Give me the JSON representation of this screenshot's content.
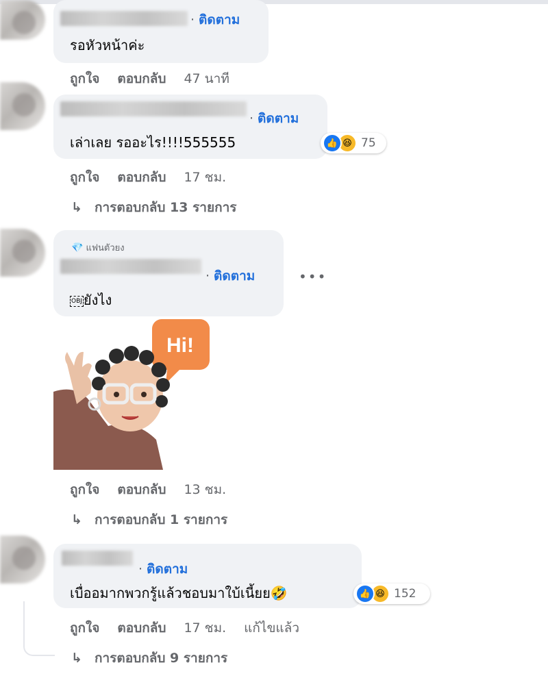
{
  "follow_label": "ติดตาม",
  "action_like": "ถูกใจ",
  "action_reply": "ตอบกลับ",
  "comments": [
    {
      "text": "รอหัวหน้าค่ะ",
      "time": "47 นาที"
    },
    {
      "text": "เล่าเลย รออะไร!!!!555555",
      "time": "17 ชม.",
      "reaction_count": "75",
      "replies": "การตอบกลับ 13 รายการ"
    },
    {
      "badge": "แฟนตัวยง",
      "text": "ยังไง",
      "emoji_box": "OBJ",
      "sticker_text": "Hi!",
      "time": "13 ชม.",
      "replies": "การตอบกลับ 1 รายการ"
    },
    {
      "text": "เบื่ออมากพวกรู้แล้วชอบมาใบ้เนี้ยย",
      "emoji": "🤣",
      "time": "17 ชม.",
      "edited": "แก้ไขแล้ว",
      "reaction_count": "152",
      "replies": "การตอบกลับ 9 รายการ"
    }
  ],
  "icons": [
    "like-icon",
    "haha-icon",
    "reply-arrow-icon",
    "diamond-icon",
    "more-options-icon"
  ]
}
